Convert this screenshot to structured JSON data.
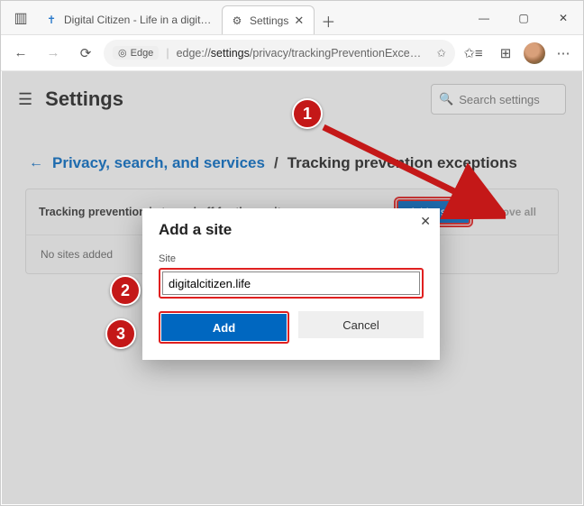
{
  "window": {
    "tabs": [
      {
        "label": "Digital Citizen - Life in a digital w",
        "favicon": "✝"
      },
      {
        "label": "Settings",
        "favicon": "⚙"
      }
    ],
    "controls": {
      "min": "—",
      "max": "▢",
      "close": "✕"
    }
  },
  "toolbar": {
    "edge_label": "Edge",
    "url_prefix": "edge://",
    "url_bold": "settings",
    "url_rest": "/privacy/trackingPreventionExce…"
  },
  "page": {
    "title": "Settings",
    "search_placeholder": "Search settings",
    "breadcrumb": {
      "link": "Privacy, search, and services",
      "current": "Tracking prevention exceptions"
    },
    "panel": {
      "heading": "Tracking prevention is turned off for these sites",
      "add_label": "Add a site",
      "remove_label": "Remove all",
      "empty": "No sites added"
    }
  },
  "dialog": {
    "title": "Add a site",
    "field_label": "Site",
    "field_value": "digitalcitizen.life",
    "add": "Add",
    "cancel": "Cancel"
  },
  "annotations": {
    "b1": "1",
    "b2": "2",
    "b3": "3"
  }
}
